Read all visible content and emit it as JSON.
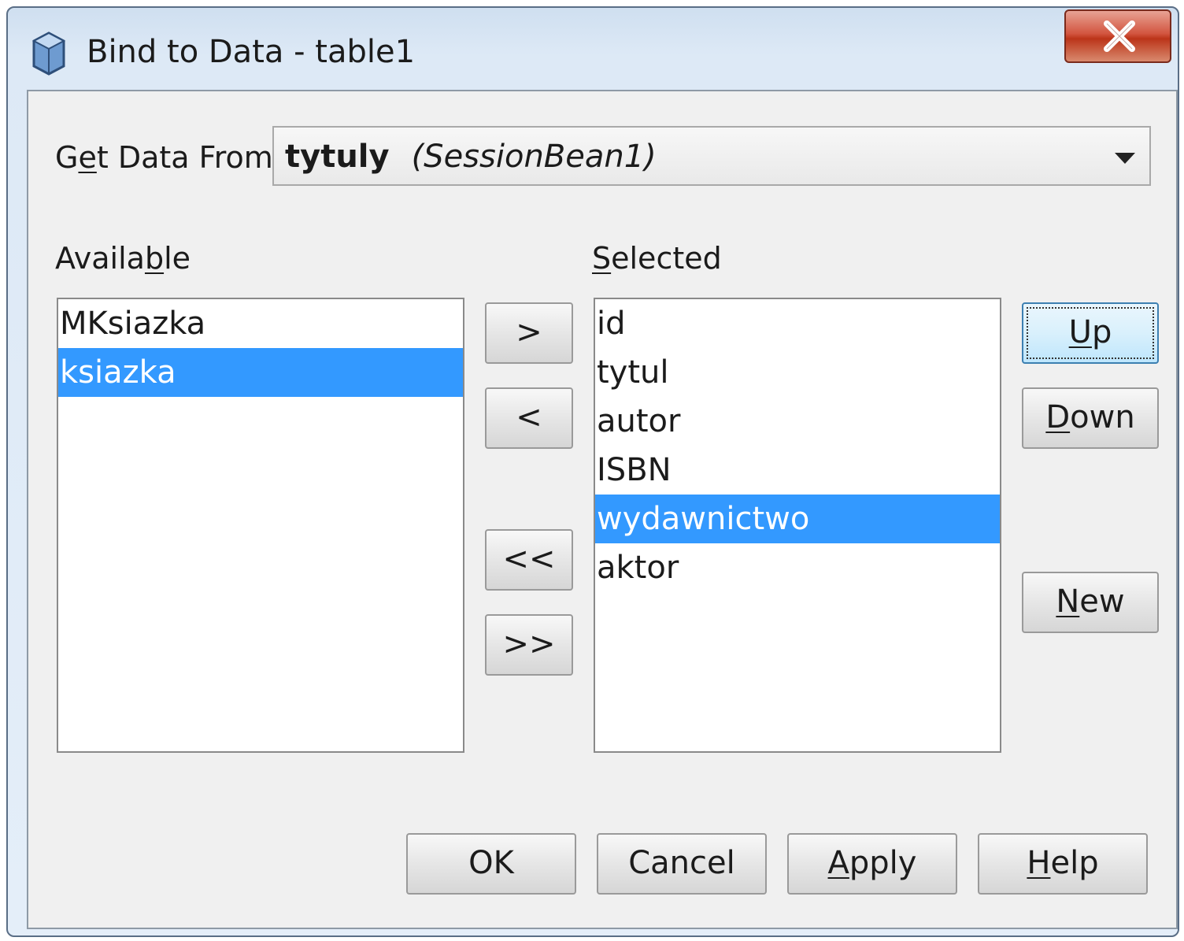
{
  "window": {
    "title": "Bind to Data - table1",
    "icon": "cube-icon",
    "close_icon": "close-icon"
  },
  "source": {
    "label_pre": "G",
    "label_u": "e",
    "label_post": "t Data From:",
    "selected_bold": "tytuly",
    "selected_italic": "(SessionBean1)"
  },
  "available": {
    "label_pre": "Availa",
    "label_u": "b",
    "label_post": "le",
    "items": [
      "MKsiazka",
      "ksiazka"
    ],
    "selected_index": 1
  },
  "selected": {
    "label_u": "S",
    "label_post": "elected",
    "items": [
      "id",
      "tytul",
      "autor",
      "ISBN",
      "wydawnictwo",
      "aktor"
    ],
    "selected_index": 4
  },
  "transfer_buttons": {
    "add": ">",
    "remove": "<",
    "remove_all": "<<",
    "add_all": ">>"
  },
  "order_buttons": {
    "up_u": "U",
    "up_post": "p",
    "down_u": "D",
    "down_post": "own",
    "new_u": "N",
    "new_post": "ew"
  },
  "footer_buttons": {
    "ok": "OK",
    "cancel": "Cancel",
    "apply_u": "A",
    "apply_post": "pply",
    "help_u": "H",
    "help_post": "elp"
  },
  "colors": {
    "selection": "#3399ff",
    "close_button": "#c9452d",
    "dialog_background": "#f0f0f0"
  }
}
